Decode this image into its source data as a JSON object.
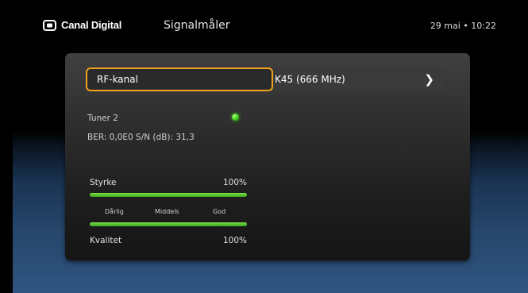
{
  "header": {
    "brand": "Canal Digital",
    "title": "Signalmåler",
    "datetime": "29 mai • 10:22"
  },
  "rf": {
    "label": "RF-kanal",
    "value": "K45 (666 MHz)",
    "chevron": "›"
  },
  "tuner": {
    "name": "Tuner 2",
    "ber_sn": "BER: 0,0E0  S/N (dB): 31,3",
    "status_color": "#3ec41c"
  },
  "strength": {
    "label": "Styrke",
    "value": "100%",
    "level": 1.0
  },
  "quality": {
    "label": "Kvalitet",
    "value": "100%",
    "level": 1.0
  },
  "scale": {
    "low": "Dårlig",
    "mid": "Middels",
    "high": "God"
  },
  "colors": {
    "accent": "#f2a21e",
    "bar": "#5ccc30"
  }
}
